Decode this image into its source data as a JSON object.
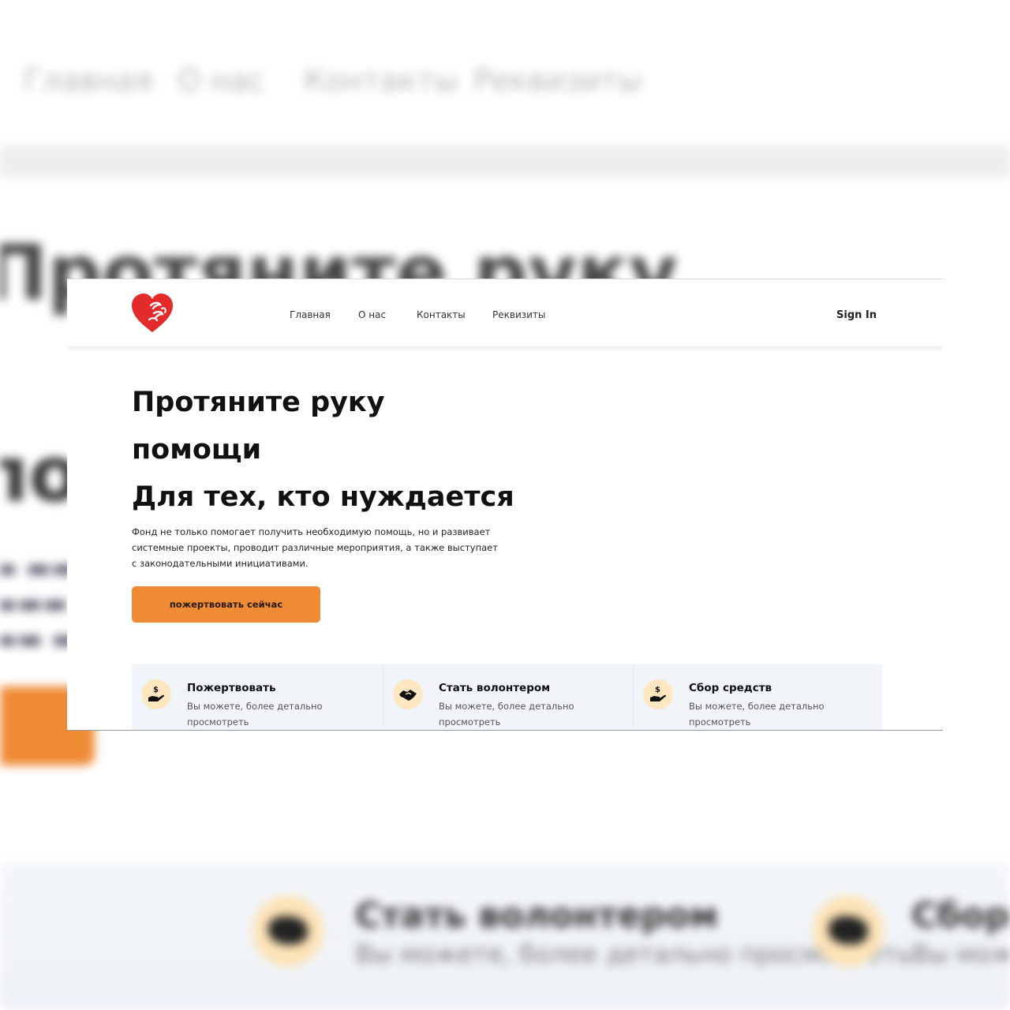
{
  "nav": {
    "items": [
      {
        "label": "Главная"
      },
      {
        "label": "О нас"
      },
      {
        "label": "Контакты"
      },
      {
        "label": "Реквизиты"
      }
    ],
    "sign_in": "Sign In"
  },
  "hero": {
    "title_lines": [
      "Протяните руку",
      "помощи",
      "Для тех, кто нуждается"
    ],
    "description": "Фонд не только помогает получить необходимую помощь, но и развивает системные проекты, проводит различные мероприятия, а также выступает с законодательными инициативами.",
    "button_label": "пожертвовать сейчас"
  },
  "features": [
    {
      "icon": "hand-dollar-icon",
      "title": "Пожертвовать",
      "text": "Вы можете, более детально просмотреть"
    },
    {
      "icon": "handshake-icon",
      "title": "Стать волонтером",
      "text": "Вы можете, более детально просмотреть"
    },
    {
      "icon": "hand-dollar-icon",
      "title": "Сбор средств",
      "text": "Вы можете, более детально просмотреть"
    }
  ],
  "colors": {
    "accent": "#ef8a35",
    "icon_circle": "#fde7c1",
    "logo_red": "#e32b2b",
    "feature_bg": "#f1f4f8"
  }
}
